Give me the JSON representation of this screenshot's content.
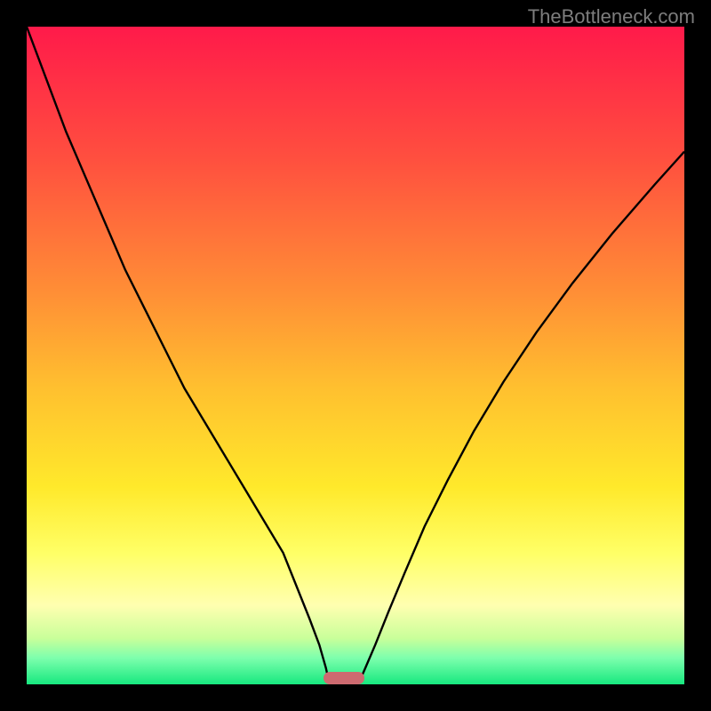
{
  "watermark": "TheBottleneck.com",
  "chart_data": {
    "type": "line",
    "title": "",
    "xlabel": "",
    "ylabel": "",
    "xlim": [
      0,
      100
    ],
    "ylim": [
      0,
      100
    ],
    "grid": false,
    "background_gradient": {
      "stops": [
        {
          "offset": 0,
          "color": "#ff1a4a"
        },
        {
          "offset": 20,
          "color": "#ff4f3f"
        },
        {
          "offset": 40,
          "color": "#ff8d36"
        },
        {
          "offset": 55,
          "color": "#ffc02f"
        },
        {
          "offset": 70,
          "color": "#ffe92b"
        },
        {
          "offset": 80,
          "color": "#ffff66"
        },
        {
          "offset": 88,
          "color": "#ffffb0"
        },
        {
          "offset": 93,
          "color": "#c9ff9a"
        },
        {
          "offset": 96,
          "color": "#7dffad"
        },
        {
          "offset": 100,
          "color": "#17e87f"
        }
      ]
    },
    "series": [
      {
        "name": "left-curve",
        "x": [
          0,
          3,
          6,
          9,
          12,
          15,
          18,
          21,
          24,
          27,
          30,
          33,
          36,
          39,
          41,
          43,
          44.5,
          45.5,
          46
        ],
        "y": [
          100,
          92,
          84,
          77,
          70,
          63,
          57,
          51,
          45,
          40,
          35,
          30,
          25,
          20,
          15,
          10,
          6,
          2.5,
          0.2
        ]
      },
      {
        "name": "right-curve",
        "x": [
          50.5,
          51.5,
          53,
          55,
          57.5,
          60.5,
          64,
          68,
          72.5,
          77.5,
          83,
          89,
          95.5,
          100
        ],
        "y": [
          0.2,
          2.5,
          6,
          11,
          17,
          24,
          31,
          38.5,
          46,
          53.5,
          61,
          68.5,
          76,
          81
        ]
      }
    ],
    "marker": {
      "x_center_pct": 48.2,
      "width_pct": 6.2,
      "color": "#cd6a70"
    }
  }
}
